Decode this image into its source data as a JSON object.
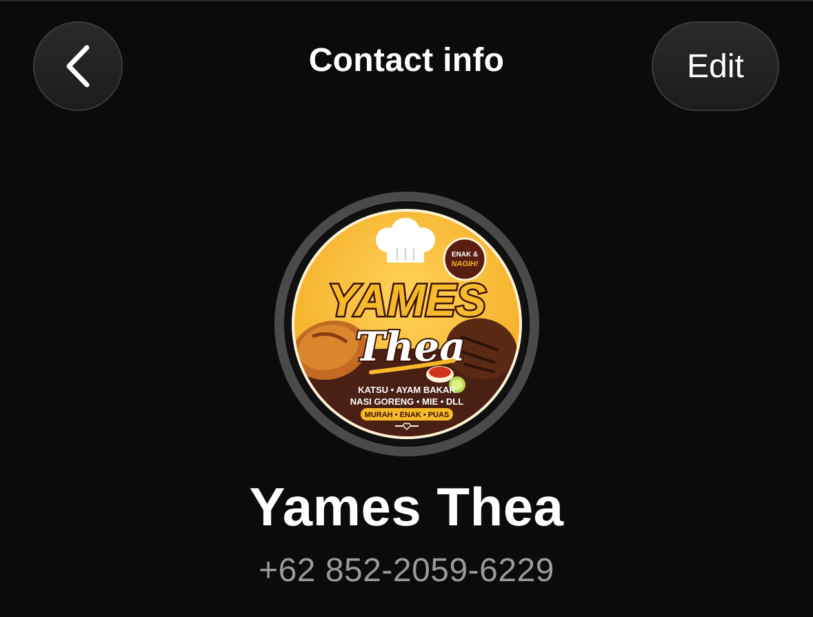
{
  "header": {
    "title": "Contact info",
    "edit_label": "Edit",
    "back_icon": "chevron-left-icon"
  },
  "avatar": {
    "logo_text": {
      "brand_top": "YAMES",
      "brand_script": "Thea",
      "badge_line1": "ENAK &",
      "badge_line2": "NAGIH!",
      "menu_line1": "KATSU • AYAM BAKAR",
      "menu_line2": "NASI GORENG • MIE • DLL",
      "ribbon": "MURAH • ENAK • PUAS"
    },
    "colors": {
      "ring": "#4a4a4a",
      "yellow": "#f6b92a",
      "brown": "#4a1f14",
      "cream": "#fff3d6"
    }
  },
  "contact": {
    "name": "Yames Thea",
    "phone": "+62 852-2059-6229"
  }
}
